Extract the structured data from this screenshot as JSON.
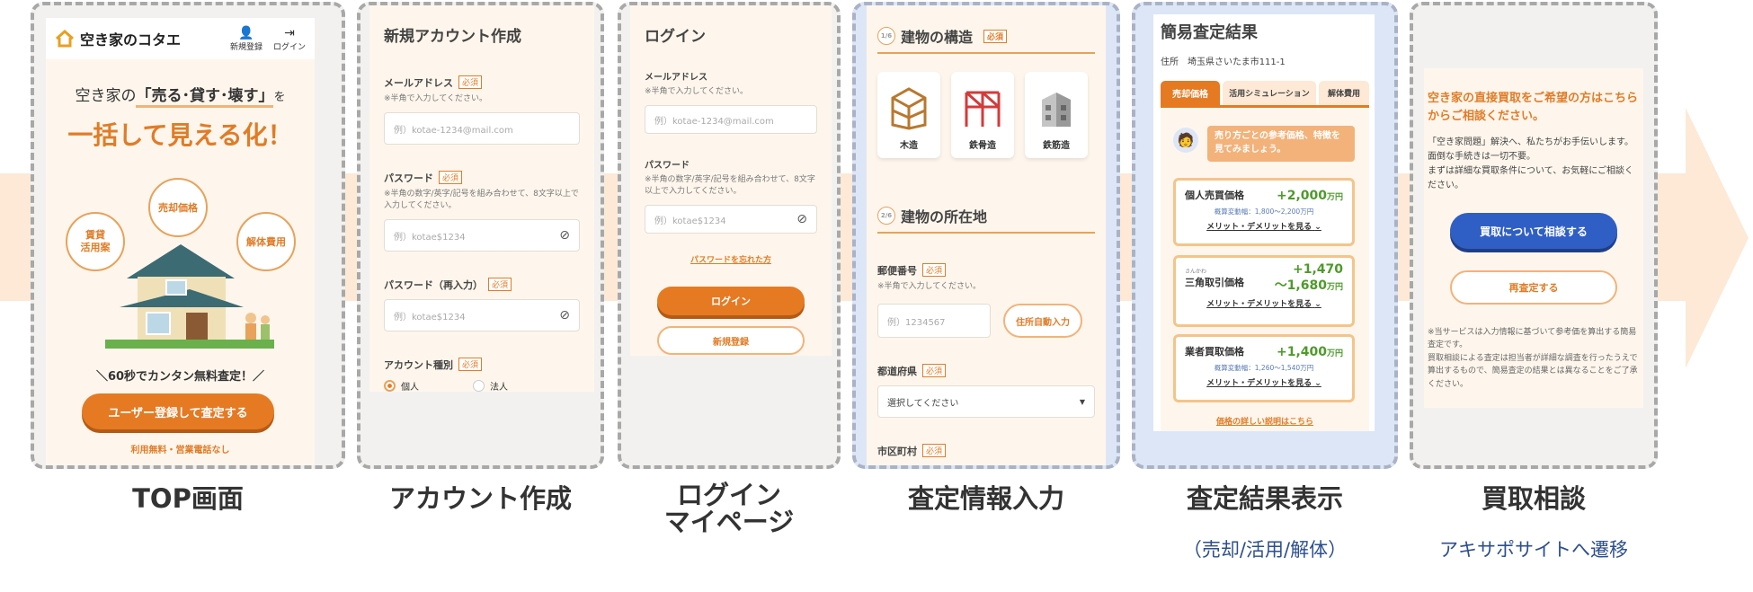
{
  "top": {
    "logo": "空き家のコタエ",
    "nav_register": "新規登録",
    "nav_login": "ログイン",
    "headline_pre": "空き家の",
    "headline_mid": "「売る･貸す･壊す」",
    "headline_post": "を",
    "headline_big": "一括して見える化！",
    "bubble_rent": "賃貸\n活用案",
    "bubble_sale": "売却価格",
    "bubble_demolish": "解体費用",
    "tagline": "＼60秒でカンタン無料査定！／",
    "cta": "ユーザー登録して査定する",
    "note": "利用無料・営業電話なし"
  },
  "account": {
    "title": "新規アカウント作成",
    "email_label": "メールアドレス",
    "required": "必須",
    "email_hint": "※半角で入力してください。",
    "email_placeholder": "例）kotae-1234@mail.com",
    "pw_label": "パスワード",
    "pw_hint": "※半角の数字/英字/記号を組み合わせて、8文字以上で入力してください。",
    "pw_placeholder": "例）kotae$1234",
    "pw2_label": "パスワード（再入力）",
    "pw2_placeholder": "例）kotae$1234",
    "type_label": "アカウント種別",
    "type_personal": "個人",
    "type_corporate": "法人"
  },
  "login": {
    "title": "ログイン",
    "email_label": "メールアドレス",
    "email_hint": "※半角で入力してください。",
    "email_placeholder": "例）kotae-1234@mail.com",
    "pw_label": "パスワード",
    "pw_hint": "※半角の数字/英字/記号を組み合わせて、8文字以上で入力してください。",
    "pw_placeholder": "例）kotae$1234",
    "forgot": "パスワードを忘れた方",
    "login_button": "ログイン",
    "register_button": "新規登録"
  },
  "input": {
    "step1": "1/6",
    "structure_title": "建物の構造",
    "required": "必須",
    "opt_wood": "木造",
    "opt_steel": "鉄骨造",
    "opt_rc": "鉄筋造",
    "step2": "2/6",
    "location_title": "建物の所在地",
    "zip_label": "郵便番号",
    "zip_hint": "※半角で入力してください。",
    "zip_placeholder": "例）1234567",
    "zip_auto": "住所自動入力",
    "pref_label": "都道府県",
    "pref_select": "選択してください",
    "city_label": "市区町村"
  },
  "result": {
    "title": "簡易査定結果",
    "address": "住所　埼玉県さいたま市111-1",
    "tab_sale": "売却価格",
    "tab_use": "活用シミュレーション",
    "tab_demo": "解体費用",
    "advisor": "売り方ごとの参考価格、特徴を見てみましょう。",
    "c1_name": "個人売買価格",
    "c1_val": "+2,000",
    "c1_unit": "万円",
    "c1_sub": "概算変動幅：1,800〜2,200万円",
    "c2_ruby": "さんかわ",
    "c2_name": "三角取引価格",
    "c2_val1": "+1,470",
    "c2_val2": "〜1,680",
    "c2_unit": "万円",
    "c3_name": "業者買取価格",
    "c3_val": "+1,400",
    "c3_unit": "万円",
    "c3_sub": "概算変動幅：1,260〜1,540万円",
    "merit": "メリット・デメリットを見る",
    "detail_link": "価格の詳しい説明はこちら"
  },
  "consult": {
    "lead": "空き家の直接買取をご希望の方はこちらからご相談ください。",
    "body": "「空き家問題」解決へ、私たちがお手伝いします。面倒な手続きは一切不要。\nまずは詳細な買取条件について、お気軽にご相談ください。",
    "consult_button": "買取について相談する",
    "reassess_button": "再査定する",
    "disclaimer": "※当サービスは入力情報に基づいて参考価を算出する簡易査定です。\n買取相談による査定は担当者が詳細な調査を行ったうえで算出するもので、簡易査定の結果とは異なることをご了承ください。"
  },
  "captions": {
    "top": "TOP画面",
    "account": "アカウント作成",
    "login1": "ログイン",
    "login2": "マイページ",
    "input": "査定情報入力",
    "result": "査定結果表示",
    "result_sub": "（売却/活用/解体）",
    "consult": "買取相談",
    "consult_sub": "アキサポサイトへ遷移"
  },
  "colors": {
    "accent_orange": "#e57a23",
    "flow_band": "#fde9d6",
    "consult_blue": "#2f5fc4",
    "value_green": "#4e9a2b"
  }
}
